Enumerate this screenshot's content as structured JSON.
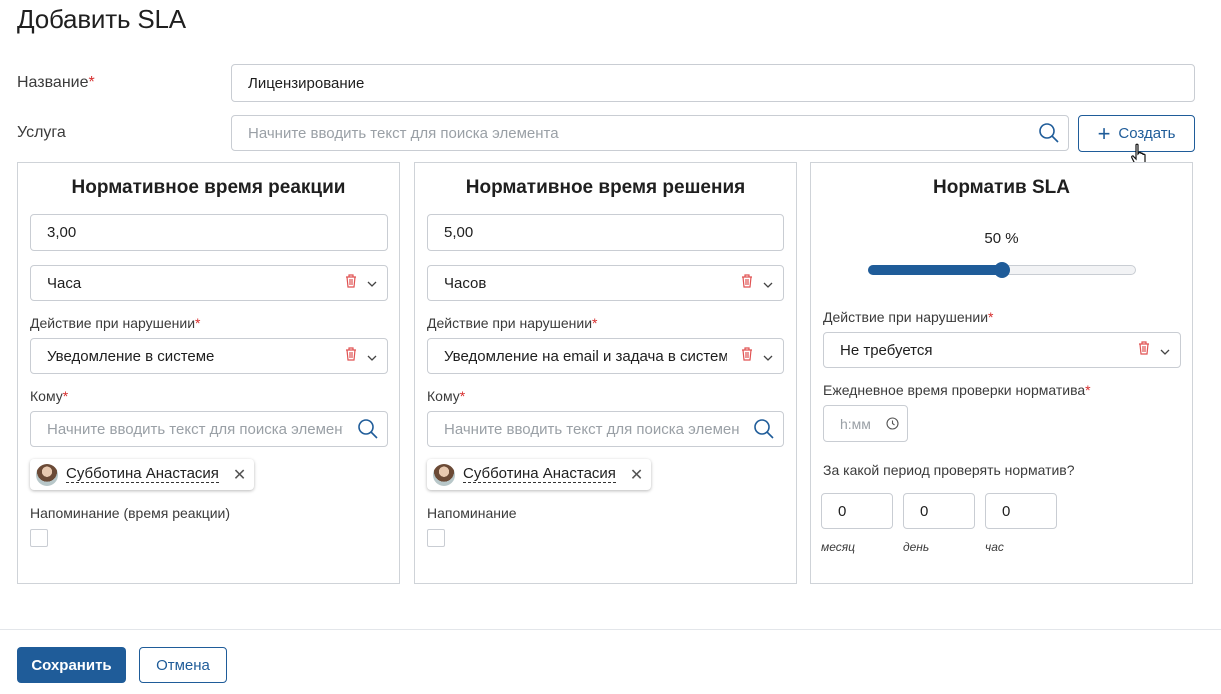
{
  "dialog": {
    "title": "Добавить SLA"
  },
  "form": {
    "name_label": "Название",
    "name_value": "Лицензирование",
    "service_label": "Услуга",
    "service_placeholder": "Начните вводить текст для поиска элемента",
    "create_button": "Создать"
  },
  "reaction": {
    "title": "Нормативное время реакции",
    "value": "3,00",
    "unit": "Часа",
    "violation_label": "Действие при нарушении",
    "violation_value": "Уведомление в системе",
    "to_label": "Кому",
    "to_placeholder": "Начните вводить текст для поиска элемента",
    "recipient": "Субботина Анастасия",
    "reminder_label": "Напоминание (время реакции)"
  },
  "resolution": {
    "title": "Нормативное время решения",
    "value": "5,00",
    "unit": "Часов",
    "violation_label": "Действие при нарушении",
    "violation_value": "Уведомление на email и задача в системе",
    "to_label": "Кому",
    "to_placeholder": "Начните вводить текст для поиска элемента",
    "recipient": "Субботина Анастасия",
    "reminder_label": "Напоминание"
  },
  "sla": {
    "title": "Норматив SLA",
    "percent_label": "50 %",
    "percent_value": 0.5,
    "violation_label": "Действие при нарушении",
    "violation_value": "Не требуется",
    "daily_check_label": "Ежедневное время проверки норматива",
    "time_placeholder": "h:мм",
    "period_question": "За какой период проверять норматив?",
    "period_values": {
      "month": "0",
      "day": "0",
      "hour": "0"
    },
    "period_labels": {
      "month": "месяц",
      "day": "день",
      "hour": "час"
    }
  },
  "footer": {
    "save": "Сохранить",
    "cancel": "Отмена"
  },
  "colors": {
    "primary": "#1f5c99",
    "required": "#d62d2d",
    "trash": "#e05252"
  }
}
